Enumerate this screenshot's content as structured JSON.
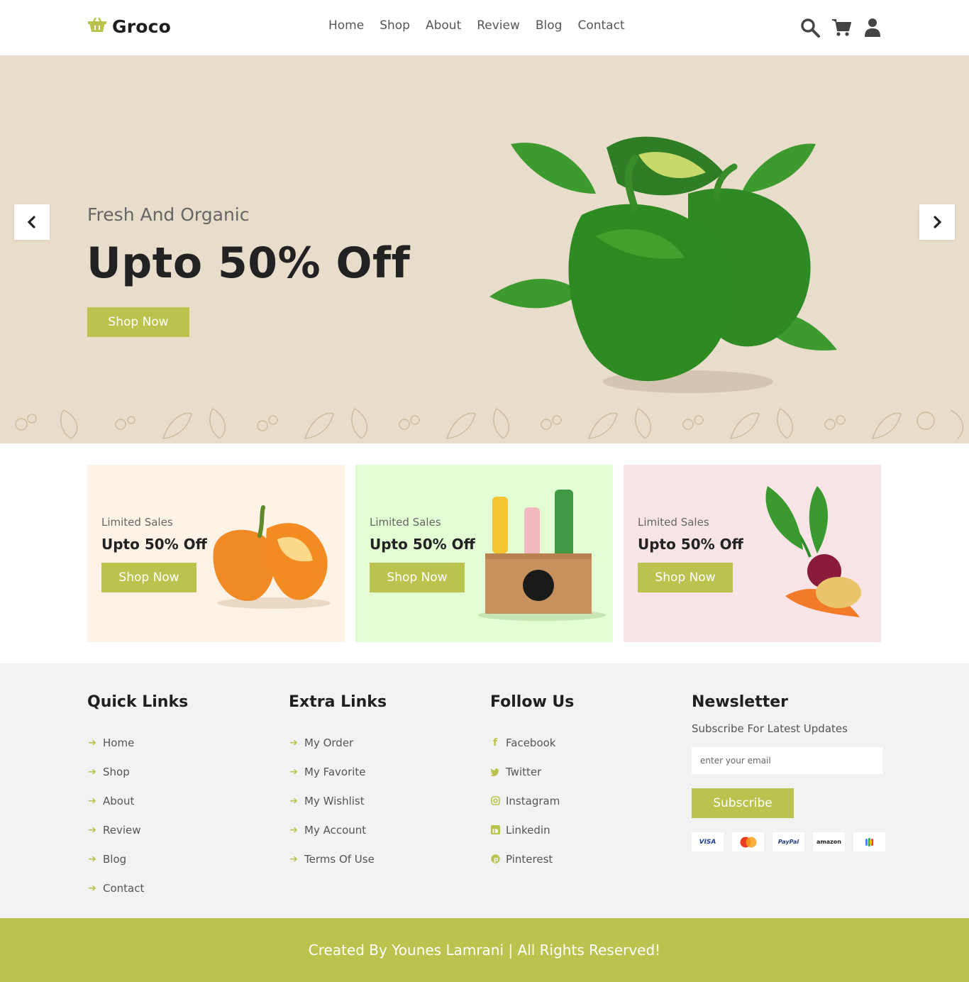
{
  "header": {
    "logo_text": "Groco",
    "nav": [
      "Home",
      "Shop",
      "About",
      "Review",
      "Blog",
      "Contact"
    ],
    "icons": [
      "search-icon",
      "cart-icon",
      "user-icon"
    ]
  },
  "hero": {
    "subtitle": "Fresh And Organic",
    "title": "Upto 50% Off",
    "button": "Shop Now"
  },
  "promos": [
    {
      "subtitle": "Limited Sales",
      "title": "Upto 50% Off",
      "button": "Shop Now",
      "bg": "#fdf2e6"
    },
    {
      "subtitle": "Limited Sales",
      "title": "Upto 50% Off",
      "button": "Shop Now",
      "bg": "#e2fcd4"
    },
    {
      "subtitle": "Limited Sales",
      "title": "Upto 50% Off",
      "button": "Shop Now",
      "bg": "#f8e4e6"
    }
  ],
  "footer": {
    "quick_links": {
      "title": "Quick Links",
      "items": [
        "Home",
        "Shop",
        "About",
        "Review",
        "Blog",
        "Contact"
      ]
    },
    "extra_links": {
      "title": "Extra Links",
      "items": [
        "My Order",
        "My Favorite",
        "My Wishlist",
        "My Account",
        "Terms Of Use"
      ]
    },
    "follow_us": {
      "title": "Follow Us",
      "items": [
        "Facebook",
        "Twitter",
        "Instagram",
        "Linkedin",
        "Pinterest"
      ]
    },
    "newsletter": {
      "title": "Newsletter",
      "subtitle": "Subscribe For Latest Updates",
      "placeholder": "enter your email",
      "button": "Subscribe",
      "payments": [
        "VISA",
        "mastercard",
        "PayPal",
        "amazon",
        "google-wallet"
      ]
    }
  },
  "credit": "Created By Younes Lamrani | All Rights Reserved!",
  "colors": {
    "accent": "#b9c34d",
    "hero_bg": "#e8dccb",
    "footer_bg": "#f2f2f2"
  }
}
